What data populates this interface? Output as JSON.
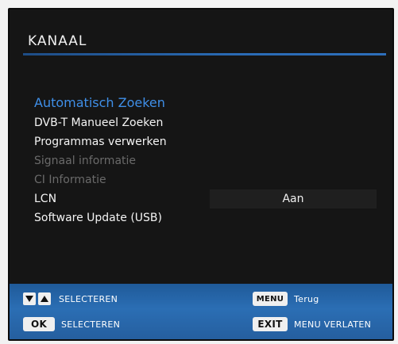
{
  "header": {
    "title": "KANAAL"
  },
  "menu": {
    "items": [
      {
        "label": "Automatisch Zoeken",
        "state": "selected"
      },
      {
        "label": "DVB-T Manueel Zoeken",
        "state": "normal"
      },
      {
        "label": "Programmas verwerken",
        "state": "normal"
      },
      {
        "label": "Signaal informatie",
        "state": "disabled"
      },
      {
        "label": "CI Informatie",
        "state": "disabled"
      },
      {
        "label": "LCN",
        "state": "normal",
        "value": "Aan"
      },
      {
        "label": "Software Update (USB)",
        "state": "normal"
      }
    ]
  },
  "footer": {
    "nav_hint": {
      "icons": [
        "down-arrow-icon",
        "up-arrow-icon"
      ],
      "text": "SELECTEREN"
    },
    "ok_hint": {
      "key": "OK",
      "text": "SELECTEREN"
    },
    "menu_hint": {
      "key": "MENU",
      "text": "Terug"
    },
    "exit_hint": {
      "key": "EXIT",
      "text": "MENU VERLATEN"
    }
  },
  "colors": {
    "background": "#151515",
    "accent": "#3f8fe8",
    "disabled": "#6a6a6a",
    "footer_blue": "#2b6eb4"
  }
}
